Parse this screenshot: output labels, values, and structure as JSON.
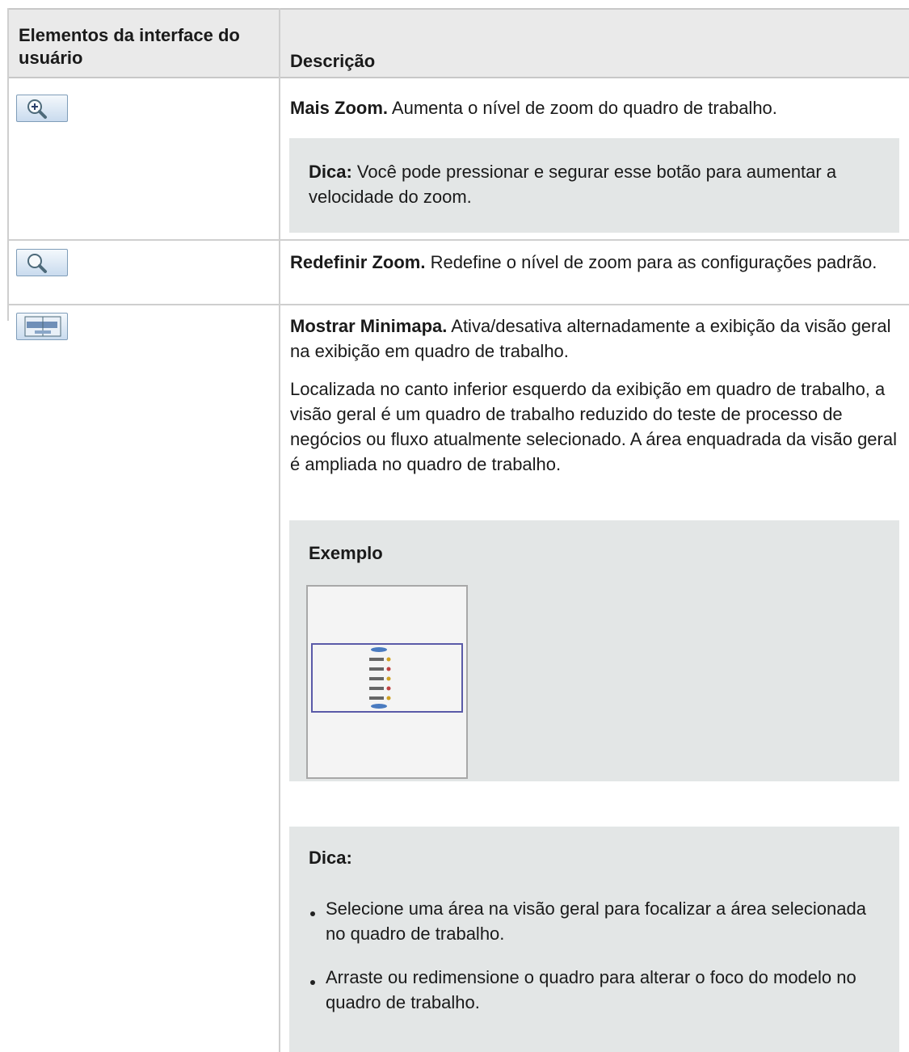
{
  "header": {
    "col1": "Elementos da interface do usuário",
    "col2": "Descrição"
  },
  "rows": [
    {
      "icon": "zoom-in-icon",
      "title": "Mais Zoom.",
      "text": " Aumenta o nível de zoom do quadro de trabalho.",
      "tip_label": "Dica:",
      "tip_text": " Você pode pressionar e segurar esse botão para aumentar a velocidade do zoom."
    },
    {
      "icon": "reset-zoom-icon",
      "title": "Redefinir Zoom.",
      "text": " Redefine o nível de zoom para as configurações padrão."
    },
    {
      "icon": "minimap-icon",
      "title": "Mostrar Minimapa.",
      "text": " Ativa/desativa alternadamente a exibição da visão geral na exibição em quadro de trabalho.",
      "paragraph": "Localizada no canto inferior esquerdo da exibição em quadro de trabalho, a visão geral é um quadro de trabalho reduzido do teste de processo de negócios ou fluxo atualmente selecionado. A área enquadrada da visão geral é ampliada no quadro de trabalho.",
      "example_label": "Exemplo",
      "tip_label": "Dica:",
      "tips": [
        "Selecione uma área na visão geral para focalizar a área selecionada no quadro de trabalho.",
        "Arraste ou redimensione o quadro para alterar o foco do modelo no quadro de trabalho."
      ]
    }
  ],
  "colors": {
    "header_bg": "#eaeaea",
    "note_bg": "#e3e6e6",
    "frame": "#5a5aa8"
  }
}
